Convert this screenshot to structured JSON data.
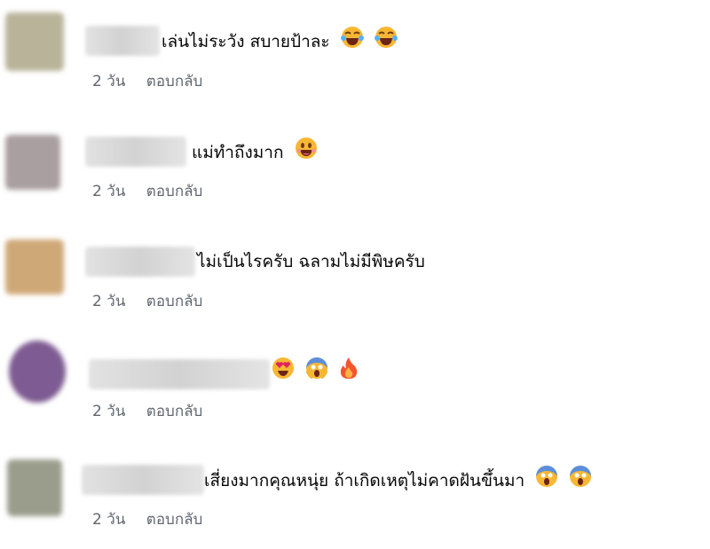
{
  "comments": [
    {
      "text": "เล่นไม่ระวัง สบายป้าละ",
      "emojis": [
        "laughing-face-icon",
        "laughing-face-icon"
      ],
      "time": "2 วัน",
      "reply": "ตอบกลับ",
      "avatar_color": "#b9b39a"
    },
    {
      "text": "แม่ทำถึงมาก",
      "emojis": [
        "grinning-face-icon"
      ],
      "time": "2 วัน",
      "reply": "ตอบกลับ",
      "avatar_color": "#a99ea0"
    },
    {
      "text": "ไม่เป็นไรครับ ฉลามไม่มีพิษครับ",
      "emojis": [],
      "time": "2 วัน",
      "reply": "ตอบกลับ",
      "avatar_color": "#cfa877"
    },
    {
      "text": "",
      "emojis": [
        "heart-eyes-face-icon",
        "screaming-face-icon",
        "fire-icon"
      ],
      "time": "2 วัน",
      "reply": "ตอบกลับ",
      "avatar_color": "#7e5b92"
    },
    {
      "text": "เสี่ยงมากคุณหนุ่ย ถ้าเกิดเหตุไม่คาดฝันขึ้นมา",
      "emojis": [
        "screaming-face-icon",
        "screaming-face-icon"
      ],
      "time": "2 วัน",
      "reply": "ตอบกลับ",
      "avatar_color": "#9a9d8c"
    }
  ]
}
